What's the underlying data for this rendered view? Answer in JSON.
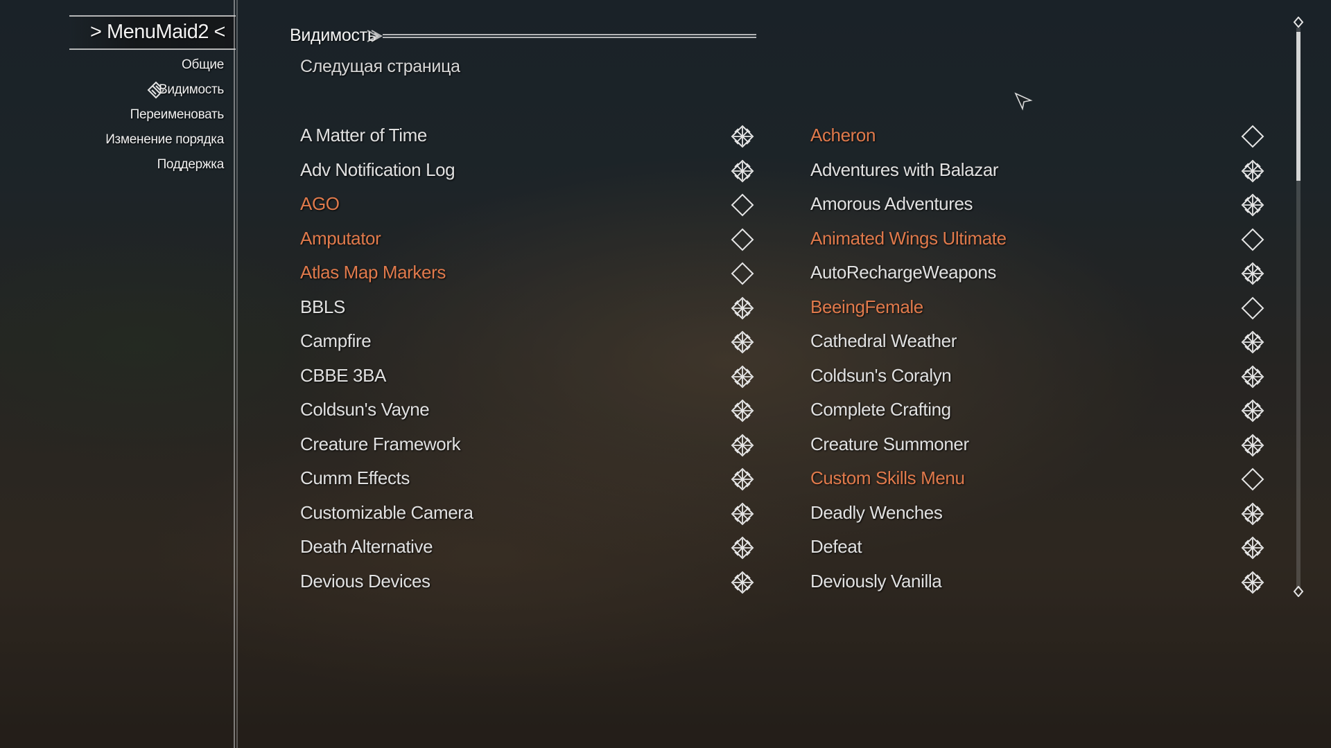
{
  "menu": {
    "title": "> MenuMaid2 <",
    "items": [
      {
        "label": "Общие",
        "selected": false
      },
      {
        "label": "Видимость",
        "selected": true
      },
      {
        "label": "Переименовать",
        "selected": false
      },
      {
        "label": "Изменение порядка",
        "selected": false
      },
      {
        "label": "Поддержка",
        "selected": false
      }
    ],
    "selected_icon": "ornament-diamond-icon"
  },
  "page": {
    "section_title": "Видимость",
    "next_page": "Следущая страница"
  },
  "left_column": [
    {
      "label": "A Matter of Time",
      "visible": true
    },
    {
      "label": "Adv Notification Log",
      "visible": true
    },
    {
      "label": "AGO",
      "visible": false
    },
    {
      "label": "Amputator",
      "visible": false
    },
    {
      "label": "Atlas Map Markers",
      "visible": false
    },
    {
      "label": "BBLS",
      "visible": true
    },
    {
      "label": "Campfire",
      "visible": true
    },
    {
      "label": "CBBE 3BA",
      "visible": true
    },
    {
      "label": "Coldsun's Vayne",
      "visible": true
    },
    {
      "label": "Creature Framework",
      "visible": true
    },
    {
      "label": "Cumm Effects",
      "visible": true
    },
    {
      "label": "Customizable Camera",
      "visible": true
    },
    {
      "label": "Death Alternative",
      "visible": true
    },
    {
      "label": "Devious Devices",
      "visible": true
    }
  ],
  "right_column": [
    {
      "label": "Acheron",
      "visible": false
    },
    {
      "label": "Adventures with Balazar",
      "visible": true
    },
    {
      "label": "Amorous Adventures",
      "visible": true
    },
    {
      "label": "Animated Wings Ultimate",
      "visible": false
    },
    {
      "label": "AutoRechargeWeapons",
      "visible": true
    },
    {
      "label": "BeeingFemale",
      "visible": false
    },
    {
      "label": "Cathedral Weather",
      "visible": true
    },
    {
      "label": "Coldsun's Coralyn",
      "visible": true
    },
    {
      "label": "Complete Crafting",
      "visible": true
    },
    {
      "label": "Creature Summoner",
      "visible": true
    },
    {
      "label": "Custom Skills Menu",
      "visible": false
    },
    {
      "label": "Deadly Wenches",
      "visible": true
    },
    {
      "label": "Defeat",
      "visible": true
    },
    {
      "label": "Deviously Vanilla",
      "visible": true
    }
  ],
  "colors": {
    "enabled_text": "#e1e1e1",
    "disabled_text": "#e07a4c",
    "icon": "#e6e6e6"
  },
  "icons": {
    "checked": "checked-ornament-icon",
    "unchecked": "empty-diamond-icon"
  }
}
